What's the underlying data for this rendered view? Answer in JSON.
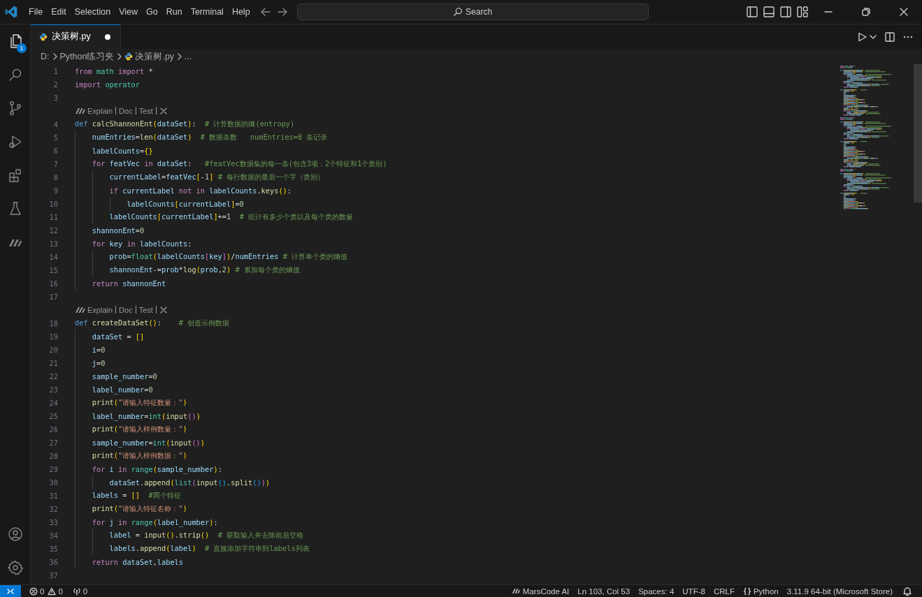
{
  "title_bar": {
    "menu": [
      "File",
      "Edit",
      "Selection",
      "View",
      "Go",
      "Run",
      "Terminal",
      "Help"
    ],
    "search": {
      "label": "Search"
    }
  },
  "activity_bar": {
    "items": [
      {
        "kind": "explorer",
        "selected": true,
        "badge": "1"
      },
      {
        "kind": "search",
        "selected": false
      },
      {
        "kind": "source_control",
        "selected": false
      },
      {
        "kind": "run_debug",
        "selected": false
      },
      {
        "kind": "extensions",
        "selected": false
      },
      {
        "kind": "testing",
        "selected": false
      },
      {
        "kind": "marscode",
        "selected": false
      }
    ],
    "bottom": [
      {
        "kind": "account"
      },
      {
        "kind": "settings"
      }
    ]
  },
  "tabs": [
    {
      "label": "决策树.py",
      "selected": true,
      "modified": true
    }
  ],
  "breadcrumb": [
    {
      "kind": "folder",
      "label": "D:"
    },
    {
      "kind": "folder",
      "label": "Python练习夹"
    },
    {
      "kind": "file",
      "label": "决策树.py"
    },
    {
      "kind": "symbol",
      "label": "..."
    }
  ],
  "editor": {
    "lines": [
      {
        "kind": "code",
        "number": "1",
        "tokens": [
          {
            "kind": "kw",
            "text": "from "
          },
          {
            "kind": "type",
            "text": "math "
          },
          {
            "kind": "kw",
            "text": "import "
          },
          {
            "kind": "op",
            "text": "*"
          }
        ]
      },
      {
        "kind": "code",
        "number": "2",
        "tokens": [
          {
            "kind": "kw",
            "text": "import "
          },
          {
            "kind": "type",
            "text": "operator"
          }
        ]
      },
      {
        "kind": "code",
        "number": "3"
      },
      {
        "kind": "codelens",
        "links": [
          "Explain",
          "Doc",
          "Test"
        ]
      },
      {
        "kind": "code",
        "number": "4",
        "tokens": [
          {
            "kind": "def",
            "text": "def "
          },
          {
            "kind": "fn",
            "text": "calcShannonEnt"
          },
          {
            "kind": "br1",
            "text": "("
          },
          {
            "kind": "var",
            "text": "dataSet"
          },
          {
            "kind": "br1",
            "text": ")"
          },
          {
            "kind": "op",
            "text": ":  "
          },
          {
            "kind": "cmt",
            "text": "# 计算数据的熵(entropy)"
          }
        ]
      },
      {
        "kind": "code",
        "number": "5",
        "tokens": [
          {
            "kind": "var",
            "text": "    numEntries"
          },
          {
            "kind": "op",
            "text": "="
          },
          {
            "kind": "fn",
            "text": "len"
          },
          {
            "kind": "br1",
            "text": "("
          },
          {
            "kind": "var",
            "text": "dataSet"
          },
          {
            "kind": "br1",
            "text": ")  "
          },
          {
            "kind": "cmt",
            "text": "# 数据条数   numEntries=8 条记录"
          }
        ]
      },
      {
        "kind": "code",
        "number": "6",
        "tokens": [
          {
            "kind": "var",
            "text": "    labelCounts"
          },
          {
            "kind": "op",
            "text": "="
          },
          {
            "kind": "br1",
            "text": "{}"
          }
        ]
      },
      {
        "kind": "code",
        "number": "7",
        "tokens": [
          {
            "kind": "kw",
            "text": "    for "
          },
          {
            "kind": "var",
            "text": "featVec "
          },
          {
            "kind": "kw",
            "text": "in "
          },
          {
            "kind": "var",
            "text": "dataSet"
          },
          {
            "kind": "op",
            "text": ":   "
          },
          {
            "kind": "cmt",
            "text": "#featVec数据集的每一条(包含3项：2个特征和1个类别)"
          }
        ]
      },
      {
        "kind": "code",
        "number": "8",
        "tokens": [
          {
            "kind": "var",
            "text": "        currentLabel"
          },
          {
            "kind": "op",
            "text": "="
          },
          {
            "kind": "var",
            "text": "featVec"
          },
          {
            "kind": "br1",
            "text": "["
          },
          {
            "kind": "op",
            "text": "-"
          },
          {
            "kind": "num",
            "text": "1"
          },
          {
            "kind": "br1",
            "text": "] "
          },
          {
            "kind": "cmt",
            "text": "# 每行数据的最后一个字（类别）"
          }
        ]
      },
      {
        "kind": "code",
        "number": "9",
        "tokens": [
          {
            "kind": "kw",
            "text": "        if "
          },
          {
            "kind": "var",
            "text": "currentLabel "
          },
          {
            "kind": "kw",
            "text": "not in "
          },
          {
            "kind": "var",
            "text": "labelCounts"
          },
          {
            "kind": "op",
            "text": "."
          },
          {
            "kind": "fn",
            "text": "keys"
          },
          {
            "kind": "br1",
            "text": "()"
          },
          {
            "kind": "op",
            "text": ":"
          }
        ]
      },
      {
        "kind": "code",
        "number": "10",
        "tokens": [
          {
            "kind": "var",
            "text": "            labelCounts"
          },
          {
            "kind": "br1",
            "text": "["
          },
          {
            "kind": "var",
            "text": "currentLabel"
          },
          {
            "kind": "br1",
            "text": "]"
          },
          {
            "kind": "op",
            "text": "="
          },
          {
            "kind": "num",
            "text": "0"
          }
        ]
      },
      {
        "kind": "code",
        "number": "11",
        "tokens": [
          {
            "kind": "var",
            "text": "        labelCounts"
          },
          {
            "kind": "br1",
            "text": "["
          },
          {
            "kind": "var",
            "text": "currentLabel"
          },
          {
            "kind": "br1",
            "text": "]"
          },
          {
            "kind": "op",
            "text": "+="
          },
          {
            "kind": "num",
            "text": "1  "
          },
          {
            "kind": "cmt",
            "text": "# 统计有多少个类以及每个类的数量"
          }
        ]
      },
      {
        "kind": "code",
        "number": "12",
        "tokens": [
          {
            "kind": "var",
            "text": "    shannonEnt"
          },
          {
            "kind": "op",
            "text": "="
          },
          {
            "kind": "num",
            "text": "0"
          }
        ]
      },
      {
        "kind": "code",
        "number": "13",
        "tokens": [
          {
            "kind": "kw",
            "text": "    for "
          },
          {
            "kind": "var",
            "text": "key "
          },
          {
            "kind": "kw",
            "text": "in "
          },
          {
            "kind": "var",
            "text": "labelCounts"
          },
          {
            "kind": "op",
            "text": ":"
          }
        ]
      },
      {
        "kind": "code",
        "number": "14",
        "tokens": [
          {
            "kind": "var",
            "text": "        prob"
          },
          {
            "kind": "op",
            "text": "="
          },
          {
            "kind": "type",
            "text": "float"
          },
          {
            "kind": "br1",
            "text": "("
          },
          {
            "kind": "var",
            "text": "labelCounts"
          },
          {
            "kind": "br2",
            "text": "["
          },
          {
            "kind": "var",
            "text": "key"
          },
          {
            "kind": "br2",
            "text": "]"
          },
          {
            "kind": "br1",
            "text": ")"
          },
          {
            "kind": "op",
            "text": "/"
          },
          {
            "kind": "var",
            "text": "numEntries "
          },
          {
            "kind": "cmt",
            "text": "# 计算单个类的熵值"
          }
        ]
      },
      {
        "kind": "code",
        "number": "15",
        "tokens": [
          {
            "kind": "var",
            "text": "        shannonEnt"
          },
          {
            "kind": "op",
            "text": "-="
          },
          {
            "kind": "var",
            "text": "prob"
          },
          {
            "kind": "op",
            "text": "*"
          },
          {
            "kind": "fn",
            "text": "log"
          },
          {
            "kind": "br1",
            "text": "("
          },
          {
            "kind": "var",
            "text": "prob"
          },
          {
            "kind": "op",
            "text": ","
          },
          {
            "kind": "num",
            "text": "2"
          },
          {
            "kind": "br1",
            "text": ") "
          },
          {
            "kind": "cmt",
            "text": "# 累加每个类的熵值"
          }
        ]
      },
      {
        "kind": "code",
        "number": "16",
        "tokens": [
          {
            "kind": "kw",
            "text": "    return "
          },
          {
            "kind": "var",
            "text": "shannonEnt"
          }
        ]
      },
      {
        "kind": "code",
        "number": "17"
      },
      {
        "kind": "codelens",
        "links": [
          "Explain",
          "Doc",
          "Test"
        ]
      },
      {
        "kind": "code",
        "number": "18",
        "tokens": [
          {
            "kind": "def",
            "text": "def "
          },
          {
            "kind": "fn",
            "text": "createDataSet"
          },
          {
            "kind": "br1",
            "text": "()"
          },
          {
            "kind": "op",
            "text": ":    "
          },
          {
            "kind": "cmt",
            "text": "# 创造示例数据"
          }
        ]
      },
      {
        "kind": "code",
        "number": "19",
        "tokens": [
          {
            "kind": "var",
            "text": "    dataSet "
          },
          {
            "kind": "op",
            "text": "= "
          },
          {
            "kind": "br1",
            "text": "[]"
          }
        ]
      },
      {
        "kind": "code",
        "number": "20",
        "tokens": [
          {
            "kind": "var",
            "text": "    i"
          },
          {
            "kind": "op",
            "text": "="
          },
          {
            "kind": "num",
            "text": "0"
          }
        ]
      },
      {
        "kind": "code",
        "number": "21",
        "tokens": [
          {
            "kind": "var",
            "text": "    j"
          },
          {
            "kind": "op",
            "text": "="
          },
          {
            "kind": "num",
            "text": "0"
          }
        ]
      },
      {
        "kind": "code",
        "number": "22",
        "tokens": [
          {
            "kind": "var",
            "text": "    sample_number"
          },
          {
            "kind": "op",
            "text": "="
          },
          {
            "kind": "num",
            "text": "0"
          }
        ]
      },
      {
        "kind": "code",
        "number": "23",
        "tokens": [
          {
            "kind": "var",
            "text": "    label_number"
          },
          {
            "kind": "op",
            "text": "="
          },
          {
            "kind": "num",
            "text": "0"
          }
        ]
      },
      {
        "kind": "code",
        "number": "24",
        "tokens": [
          {
            "kind": "fn",
            "text": "    print"
          },
          {
            "kind": "br1",
            "text": "("
          },
          {
            "kind": "str",
            "text": "\"请输入特征数量：\""
          },
          {
            "kind": "br1",
            "text": ")"
          }
        ]
      },
      {
        "kind": "code",
        "number": "25",
        "tokens": [
          {
            "kind": "var",
            "text": "    label_number"
          },
          {
            "kind": "op",
            "text": "="
          },
          {
            "kind": "type",
            "text": "int"
          },
          {
            "kind": "br1",
            "text": "("
          },
          {
            "kind": "fn",
            "text": "input"
          },
          {
            "kind": "br2",
            "text": "()"
          },
          {
            "kind": "br1",
            "text": ")"
          }
        ]
      },
      {
        "kind": "code",
        "number": "26",
        "tokens": [
          {
            "kind": "fn",
            "text": "    print"
          },
          {
            "kind": "br1",
            "text": "("
          },
          {
            "kind": "str",
            "text": "\"请输入样例数量：\""
          },
          {
            "kind": "br1",
            "text": ")"
          }
        ]
      },
      {
        "kind": "code",
        "number": "27",
        "tokens": [
          {
            "kind": "var",
            "text": "    sample_number"
          },
          {
            "kind": "op",
            "text": "="
          },
          {
            "kind": "type",
            "text": "int"
          },
          {
            "kind": "br1",
            "text": "("
          },
          {
            "kind": "fn",
            "text": "input"
          },
          {
            "kind": "br2",
            "text": "()"
          },
          {
            "kind": "br1",
            "text": ")"
          }
        ]
      },
      {
        "kind": "code",
        "number": "28",
        "tokens": [
          {
            "kind": "fn",
            "text": "    print"
          },
          {
            "kind": "br1",
            "text": "("
          },
          {
            "kind": "str",
            "text": "\"请输入样例数据：\""
          },
          {
            "kind": "br1",
            "text": ")"
          }
        ]
      },
      {
        "kind": "code",
        "number": "29",
        "tokens": [
          {
            "kind": "kw",
            "text": "    for "
          },
          {
            "kind": "var",
            "text": "i "
          },
          {
            "kind": "kw",
            "text": "in "
          },
          {
            "kind": "type",
            "text": "range"
          },
          {
            "kind": "br1",
            "text": "("
          },
          {
            "kind": "var",
            "text": "sample_number"
          },
          {
            "kind": "br1",
            "text": ")"
          },
          {
            "kind": "op",
            "text": ":"
          }
        ]
      },
      {
        "kind": "code",
        "number": "30",
        "tokens": [
          {
            "kind": "var",
            "text": "        dataSet"
          },
          {
            "kind": "op",
            "text": "."
          },
          {
            "kind": "fn",
            "text": "append"
          },
          {
            "kind": "br1",
            "text": "("
          },
          {
            "kind": "type",
            "text": "list"
          },
          {
            "kind": "br2",
            "text": "("
          },
          {
            "kind": "fn",
            "text": "input"
          },
          {
            "kind": "br3",
            "text": "()"
          },
          {
            "kind": "op",
            "text": "."
          },
          {
            "kind": "fn",
            "text": "split"
          },
          {
            "kind": "br3",
            "text": "()"
          },
          {
            "kind": "br2",
            "text": ")"
          },
          {
            "kind": "br1",
            "text": ")"
          }
        ]
      },
      {
        "kind": "code",
        "number": "31",
        "tokens": [
          {
            "kind": "var",
            "text": "    labels "
          },
          {
            "kind": "op",
            "text": "= "
          },
          {
            "kind": "br1",
            "text": "[]  "
          },
          {
            "kind": "cmt",
            "text": "#两个特征"
          }
        ]
      },
      {
        "kind": "code",
        "number": "32",
        "tokens": [
          {
            "kind": "fn",
            "text": "    print"
          },
          {
            "kind": "br1",
            "text": "("
          },
          {
            "kind": "str",
            "text": "\"请输入特征名称：\""
          },
          {
            "kind": "br1",
            "text": ")"
          }
        ]
      },
      {
        "kind": "code",
        "number": "33",
        "tokens": [
          {
            "kind": "kw",
            "text": "    for "
          },
          {
            "kind": "var",
            "text": "j "
          },
          {
            "kind": "kw",
            "text": "in "
          },
          {
            "kind": "type",
            "text": "range"
          },
          {
            "kind": "br1",
            "text": "("
          },
          {
            "kind": "var",
            "text": "label_number"
          },
          {
            "kind": "br1",
            "text": ")"
          },
          {
            "kind": "op",
            "text": ":"
          }
        ]
      },
      {
        "kind": "code",
        "number": "34",
        "tokens": [
          {
            "kind": "var",
            "text": "        label "
          },
          {
            "kind": "op",
            "text": "= "
          },
          {
            "kind": "fn",
            "text": "input"
          },
          {
            "kind": "br1",
            "text": "()"
          },
          {
            "kind": "op",
            "text": "."
          },
          {
            "kind": "fn",
            "text": "strip"
          },
          {
            "kind": "br1",
            "text": "()  "
          },
          {
            "kind": "cmt",
            "text": "# 获取输入并去除前后空格"
          }
        ]
      },
      {
        "kind": "code",
        "number": "35",
        "tokens": [
          {
            "kind": "var",
            "text": "        labels"
          },
          {
            "kind": "op",
            "text": "."
          },
          {
            "kind": "fn",
            "text": "append"
          },
          {
            "kind": "br1",
            "text": "("
          },
          {
            "kind": "var",
            "text": "label"
          },
          {
            "kind": "br1",
            "text": ")  "
          },
          {
            "kind": "cmt",
            "text": "# 直接添加字符串到labels列表"
          }
        ]
      },
      {
        "kind": "code",
        "number": "36",
        "tokens": [
          {
            "kind": "kw",
            "text": "    return "
          },
          {
            "kind": "var",
            "text": "dataSet"
          },
          {
            "kind": "op",
            "text": ","
          },
          {
            "kind": "var",
            "text": "labels"
          }
        ]
      },
      {
        "kind": "code",
        "number": "37"
      }
    ]
  },
  "status_bar": {
    "errors": "0",
    "warnings": "0",
    "ports": "0",
    "right": [
      {
        "kind": "marscode",
        "label": "MarsCode AI"
      },
      {
        "kind": "text",
        "label": "Ln 103, Col 53"
      },
      {
        "kind": "text",
        "label": "Spaces: 4"
      },
      {
        "kind": "text",
        "label": "UTF-8"
      },
      {
        "kind": "text",
        "label": "CRLF"
      },
      {
        "kind": "language",
        "label": "Python"
      },
      {
        "kind": "text",
        "label": "3.11.9 64-bit (Microsoft Store)"
      },
      {
        "kind": "bell"
      }
    ]
  }
}
